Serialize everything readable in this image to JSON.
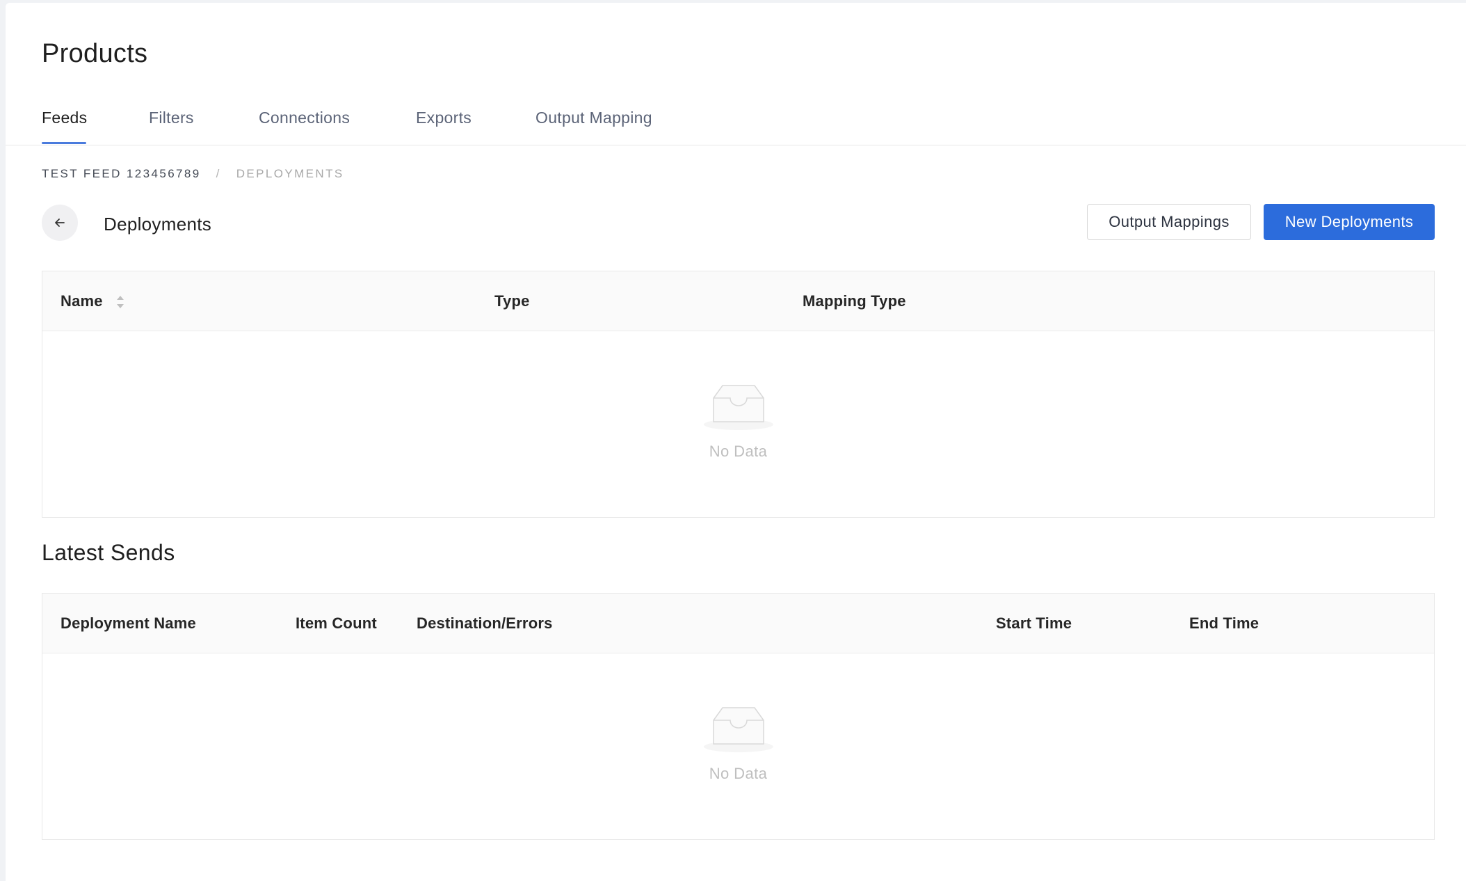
{
  "page": {
    "title": "Products"
  },
  "tabs": [
    {
      "label": "Feeds",
      "active": true
    },
    {
      "label": "Filters",
      "active": false
    },
    {
      "label": "Connections",
      "active": false
    },
    {
      "label": "Exports",
      "active": false
    },
    {
      "label": "Output Mapping",
      "active": false
    }
  ],
  "breadcrumb": {
    "parent": "TEST FEED 123456789",
    "separator": "/",
    "current": "DEPLOYMENTS"
  },
  "deployments": {
    "title": "Deployments",
    "back_icon": "arrow-left-icon",
    "output_mappings_label": "Output Mappings",
    "new_deployments_label": "New Deployments",
    "columns": [
      "Name",
      "Type",
      "Mapping Type"
    ],
    "sortable_column": "Name",
    "rows": [],
    "empty_text": "No Data"
  },
  "latest_sends": {
    "title": "Latest Sends",
    "columns": [
      "Deployment Name",
      "Item Count",
      "Destination/Errors",
      "Start Time",
      "End Time"
    ],
    "rows": [],
    "empty_text": "No Data"
  },
  "colors": {
    "primary": "#2c6cdc",
    "tab_ink": "#4a7bdd",
    "empty_text": "#bfbfbf"
  }
}
